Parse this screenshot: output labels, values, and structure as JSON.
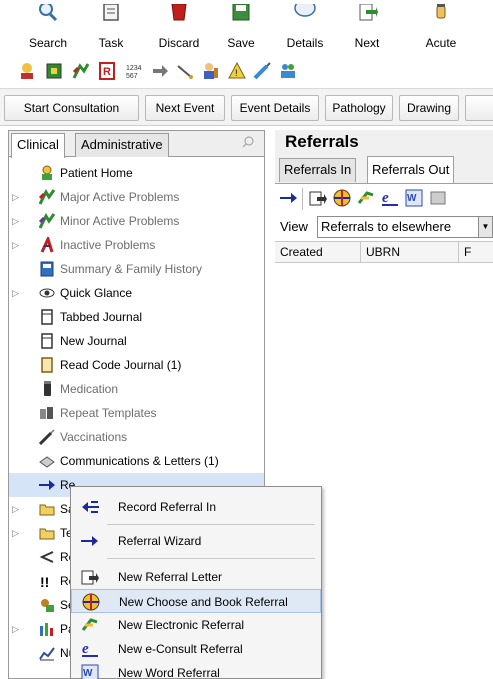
{
  "toolbar": {
    "buttons": [
      {
        "label": "Search",
        "icon": "search-icon"
      },
      {
        "label": "Task",
        "icon": "task-icon"
      },
      {
        "label": "Discard",
        "icon": "discard-icon"
      },
      {
        "label": "Save",
        "icon": "save-icon"
      },
      {
        "label": "Details",
        "icon": "details-icon"
      },
      {
        "label": "Next",
        "icon": "next-icon"
      },
      {
        "label": "Acute",
        "icon": "acute-icon"
      }
    ]
  },
  "button_bar": {
    "buttons": [
      "Start Consultation",
      "Next Event",
      "Event Details",
      "Pathology",
      "Drawing"
    ]
  },
  "left_panel": {
    "tabs": [
      "Clinical",
      "Administrative"
    ],
    "tree": [
      {
        "label": "Patient Home",
        "icon": "patient-home-icon"
      },
      {
        "label": "Major Active Problems",
        "icon": "major-problems-icon"
      },
      {
        "label": "Minor Active Problems",
        "icon": "minor-problems-icon"
      },
      {
        "label": "Inactive Problems",
        "icon": "inactive-problems-icon"
      },
      {
        "label": "Summary & Family History",
        "icon": "summary-icon"
      },
      {
        "label": "Quick Glance",
        "icon": "quick-glance-icon"
      },
      {
        "label": "Tabbed Journal",
        "icon": "tabbed-journal-icon"
      },
      {
        "label": "New Journal",
        "icon": "new-journal-icon"
      },
      {
        "label": "Read Code Journal (1)",
        "icon": "read-code-journal-icon"
      },
      {
        "label": "Medication",
        "icon": "medication-icon"
      },
      {
        "label": "Repeat Templates",
        "icon": "repeat-templates-icon"
      },
      {
        "label": "Vaccinations",
        "icon": "vaccinations-icon"
      },
      {
        "label": "Communications & Letters (1)",
        "icon": "communications-icon"
      },
      {
        "label": "Re",
        "icon": "referrals-icon"
      },
      {
        "label": "Sa",
        "icon": "folder-icon"
      },
      {
        "label": "Te",
        "icon": "folder-icon"
      },
      {
        "label": "Re",
        "icon": "results-icon"
      },
      {
        "label": "Re",
        "icon": "alerts-icon"
      },
      {
        "label": "Se",
        "icon": "settings-icon"
      },
      {
        "label": "Pa",
        "icon": "chart-icon"
      },
      {
        "label": "Nu",
        "icon": "numeric-icon"
      }
    ]
  },
  "right_panel": {
    "title": "Referrals",
    "tabs": [
      "Referrals In",
      "Referrals Out"
    ],
    "view_label": "View",
    "view_value": "Referrals to elsewhere",
    "columns": [
      "Created",
      "UBRN",
      "F"
    ]
  },
  "context_menu": {
    "items": [
      {
        "label": "Record Referral In",
        "icon": "record-referral-in-icon"
      },
      {
        "label": "Referral Wizard",
        "icon": "referral-wizard-icon"
      },
      {
        "label": "New Referral Letter",
        "icon": "referral-letter-icon"
      },
      {
        "label": "New Choose and Book Referral",
        "icon": "choose-and-book-icon"
      },
      {
        "label": "New Electronic Referral",
        "icon": "electronic-referral-icon"
      },
      {
        "label": "New e-Consult Referral",
        "icon": "econsult-icon"
      },
      {
        "label": "New Word Referral",
        "icon": "word-referral-icon"
      }
    ]
  }
}
